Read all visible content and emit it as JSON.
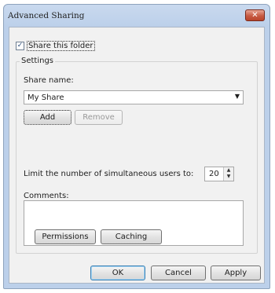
{
  "window": {
    "title": "Advanced Sharing",
    "close_glyph": "✕"
  },
  "share_folder": {
    "checked": true,
    "check_glyph": "✓",
    "label": "Share this folder"
  },
  "settings": {
    "group_title": "Settings",
    "share_name_label": "Share name:",
    "share_name_value": "My Share",
    "dropdown_glyph": "▼",
    "add_label": "Add",
    "remove_label": "Remove",
    "limit_label": "Limit the number of simultaneous users to:",
    "limit_value": "20",
    "spin_up_glyph": "▲",
    "spin_down_glyph": "▼",
    "comments_label": "Comments:",
    "comments_value": "",
    "permissions_label": "Permissions",
    "caching_label": "Caching"
  },
  "footer": {
    "ok_label": "OK",
    "cancel_label": "Cancel",
    "apply_label": "Apply"
  }
}
